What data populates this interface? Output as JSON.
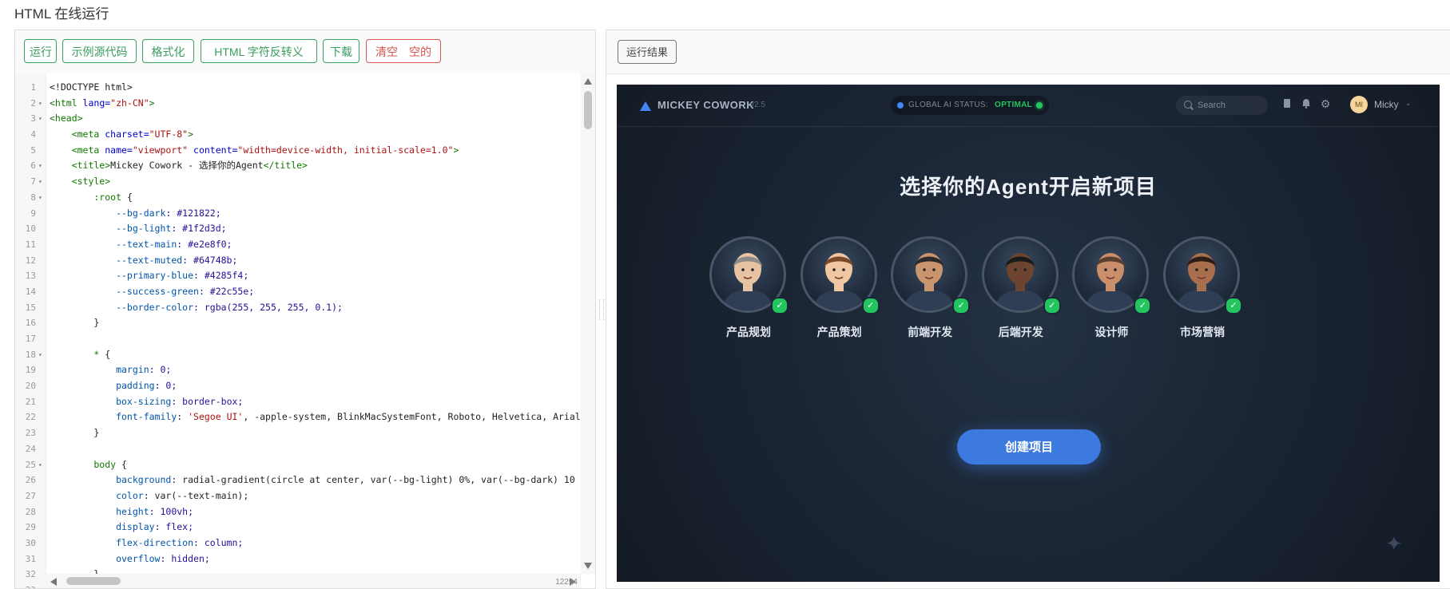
{
  "page": {
    "title": "HTML 在线运行"
  },
  "left_toolbar": {
    "run": "运行",
    "example": "示例源代码",
    "format": "格式化",
    "escape": "HTML 字符反转义",
    "download": "下载",
    "clear": "清空　空的"
  },
  "editor": {
    "char_count": "12294",
    "lines": [
      {
        "n": "1",
        "f": ""
      },
      {
        "n": "2",
        "f": "▾"
      },
      {
        "n": "3",
        "f": "▾"
      },
      {
        "n": "4",
        "f": ""
      },
      {
        "n": "5",
        "f": ""
      },
      {
        "n": "6",
        "f": "▾"
      },
      {
        "n": "7",
        "f": "▾"
      },
      {
        "n": "8",
        "f": "▾"
      },
      {
        "n": "9",
        "f": ""
      },
      {
        "n": "10",
        "f": ""
      },
      {
        "n": "11",
        "f": ""
      },
      {
        "n": "12",
        "f": ""
      },
      {
        "n": "13",
        "f": ""
      },
      {
        "n": "14",
        "f": ""
      },
      {
        "n": "15",
        "f": ""
      },
      {
        "n": "16",
        "f": ""
      },
      {
        "n": "17",
        "f": ""
      },
      {
        "n": "18",
        "f": "▾"
      },
      {
        "n": "19",
        "f": ""
      },
      {
        "n": "20",
        "f": ""
      },
      {
        "n": "21",
        "f": ""
      },
      {
        "n": "22",
        "f": ""
      },
      {
        "n": "23",
        "f": ""
      },
      {
        "n": "24",
        "f": ""
      },
      {
        "n": "25",
        "f": "▾"
      },
      {
        "n": "26",
        "f": ""
      },
      {
        "n": "27",
        "f": ""
      },
      {
        "n": "28",
        "f": ""
      },
      {
        "n": "29",
        "f": ""
      },
      {
        "n": "30",
        "f": ""
      },
      {
        "n": "31",
        "f": ""
      },
      {
        "n": "32",
        "f": ""
      },
      {
        "n": "33",
        "f": ""
      }
    ],
    "code": [
      [
        {
          "t": "<!DOCTYPE html>",
          "c": ""
        }
      ],
      [
        {
          "t": "<html",
          "c": "tg"
        },
        {
          "t": " lang=",
          "c": "at"
        },
        {
          "t": "\"zh-CN\"",
          "c": "st"
        },
        {
          "t": ">",
          "c": "tg"
        }
      ],
      [
        {
          "t": "<head>",
          "c": "tg"
        }
      ],
      [
        {
          "t": "    <meta",
          "c": "tg"
        },
        {
          "t": " charset=",
          "c": "at"
        },
        {
          "t": "\"UTF-8\"",
          "c": "st"
        },
        {
          "t": ">",
          "c": "tg"
        }
      ],
      [
        {
          "t": "    <meta",
          "c": "tg"
        },
        {
          "t": " name=",
          "c": "at"
        },
        {
          "t": "\"viewport\"",
          "c": "st"
        },
        {
          "t": " content=",
          "c": "at"
        },
        {
          "t": "\"width=device-width, initial-scale=1.0\"",
          "c": "st"
        },
        {
          "t": ">",
          "c": "tg"
        }
      ],
      [
        {
          "t": "    <title>",
          "c": "tg"
        },
        {
          "t": "Mickey Cowork - 选择你的Agent",
          "c": ""
        },
        {
          "t": "</title>",
          "c": "tg"
        }
      ],
      [
        {
          "t": "    <style>",
          "c": "tg"
        }
      ],
      [
        {
          "t": "        :root ",
          "c": "tg"
        },
        {
          "t": "{",
          "c": ""
        }
      ],
      [
        {
          "t": "            --bg-dark",
          "c": "pr"
        },
        {
          "t": ": #121822;",
          "c": "kw"
        }
      ],
      [
        {
          "t": "            --bg-light",
          "c": "pr"
        },
        {
          "t": ": #1f2d3d;",
          "c": "kw"
        }
      ],
      [
        {
          "t": "            --text-main",
          "c": "pr"
        },
        {
          "t": ": #e2e8f0;",
          "c": "kw"
        }
      ],
      [
        {
          "t": "            --text-muted",
          "c": "pr"
        },
        {
          "t": ": #64748b;",
          "c": "kw"
        }
      ],
      [
        {
          "t": "            --primary-blue",
          "c": "pr"
        },
        {
          "t": ": #4285f4;",
          "c": "kw"
        }
      ],
      [
        {
          "t": "            --success-green",
          "c": "pr"
        },
        {
          "t": ": #22c55e;",
          "c": "kw"
        }
      ],
      [
        {
          "t": "            --border-color",
          "c": "pr"
        },
        {
          "t": ": rgba(255, 255, 255, 0.1);",
          "c": "kw"
        }
      ],
      [
        {
          "t": "        }",
          "c": ""
        }
      ],
      [
        {
          "t": "",
          "c": ""
        }
      ],
      [
        {
          "t": "        * ",
          "c": "tg"
        },
        {
          "t": "{",
          "c": ""
        }
      ],
      [
        {
          "t": "            margin",
          "c": "pr"
        },
        {
          "t": ": 0;",
          "c": "kw"
        }
      ],
      [
        {
          "t": "            padding",
          "c": "pr"
        },
        {
          "t": ": 0;",
          "c": "kw"
        }
      ],
      [
        {
          "t": "            box-sizing",
          "c": "pr"
        },
        {
          "t": ": border-box;",
          "c": "kw"
        }
      ],
      [
        {
          "t": "            font-family",
          "c": "pr"
        },
        {
          "t": ": ",
          "c": ""
        },
        {
          "t": "'Segoe UI'",
          "c": "st"
        },
        {
          "t": ", -apple-system, BlinkMacSystemFont, Roboto, Helvetica, Arial",
          "c": ""
        }
      ],
      [
        {
          "t": "        }",
          "c": ""
        }
      ],
      [
        {
          "t": "",
          "c": ""
        }
      ],
      [
        {
          "t": "        body ",
          "c": "tg"
        },
        {
          "t": "{",
          "c": ""
        }
      ],
      [
        {
          "t": "            background",
          "c": "pr"
        },
        {
          "t": ": radial-gradient(circle at center, var(--bg-light) 0%, var(--bg-dark) 10",
          "c": ""
        }
      ],
      [
        {
          "t": "            color",
          "c": "pr"
        },
        {
          "t": ": var(--text-main);",
          "c": ""
        }
      ],
      [
        {
          "t": "            height",
          "c": "pr"
        },
        {
          "t": ": 100vh;",
          "c": "kw"
        }
      ],
      [
        {
          "t": "            display",
          "c": "pr"
        },
        {
          "t": ": flex;",
          "c": "kw"
        }
      ],
      [
        {
          "t": "            flex-direction",
          "c": "pr"
        },
        {
          "t": ": column;",
          "c": "kw"
        }
      ],
      [
        {
          "t": "            overflow",
          "c": "pr"
        },
        {
          "t": ": hidden;",
          "c": "kw"
        }
      ],
      [
        {
          "t": "        }",
          "c": ""
        }
      ],
      [
        {
          "t": "",
          "c": ""
        }
      ]
    ]
  },
  "right_toolbar": {
    "result": "运行结果"
  },
  "app": {
    "brand": "MICKEY COWORK",
    "version": "v2.5",
    "status_label": "GLOBAL AI STATUS:",
    "status_value": "OPTIMAL",
    "search_placeholder": "Search",
    "avatar_initials": "MI",
    "user_name": "Micky",
    "hero_title": "选择你的Agent开启新项目",
    "agents": [
      {
        "label": "产品规划",
        "skin": "#e8c3a3",
        "hair": "#8a8a8a"
      },
      {
        "label": "产品策划",
        "skin": "#f0c7a2",
        "hair": "#7a4a2a"
      },
      {
        "label": "前端开发",
        "skin": "#c8956e",
        "hair": "#2a2a2a"
      },
      {
        "label": "后端开发",
        "skin": "#6b4530",
        "hair": "#1a1a1a"
      },
      {
        "label": "设计师",
        "skin": "#c88f6a",
        "hair": "#5a3f2e"
      },
      {
        "label": "市场营销",
        "skin": "#a86f4e",
        "hair": "#2d1d14"
      }
    ],
    "create_button": "创建项目",
    "colors": {
      "accent": "#4285f4",
      "success": "#22c55e",
      "bg_dark": "#121822",
      "bg_light": "#1f2d3d"
    }
  }
}
